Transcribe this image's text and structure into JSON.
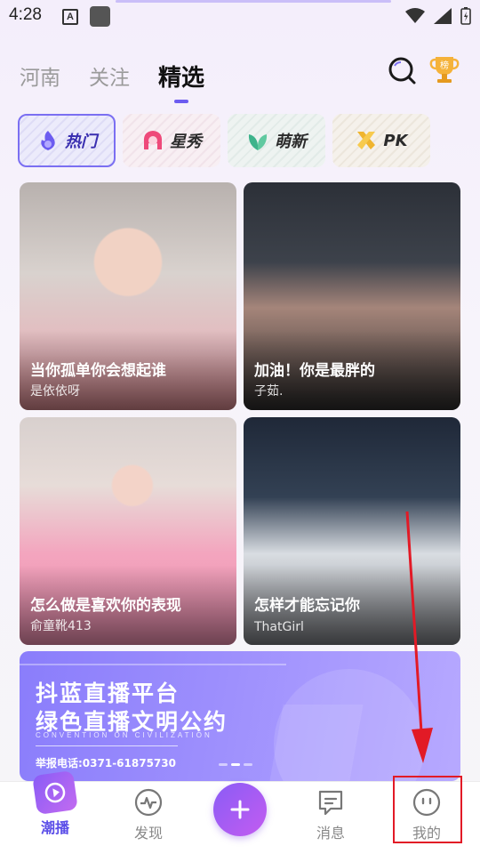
{
  "status_bar": {
    "time": "4:28",
    "a_icon": "A"
  },
  "tabs": [
    {
      "label": "河南",
      "active": false
    },
    {
      "label": "关注",
      "active": false
    },
    {
      "label": "精选",
      "active": true
    }
  ],
  "header_icons": {
    "search": "search-icon",
    "trophy": "trophy-icon",
    "trophy_badge": "榜"
  },
  "categories": [
    {
      "label": "热门",
      "icon": "fire-icon",
      "active": true
    },
    {
      "label": "星秀",
      "icon": "girl-icon",
      "active": false
    },
    {
      "label": "萌新",
      "icon": "leaf-icon",
      "active": false
    },
    {
      "label": "PK",
      "icon": "crossed-swords-icon",
      "active": false
    }
  ],
  "cards": [
    {
      "title": "当你孤单你会想起谁",
      "user": "是依依呀"
    },
    {
      "title": "加油！你是最胖的",
      "user": "子茹."
    },
    {
      "title": "怎么做是喜欢你的表现",
      "user": "俞童靴413"
    },
    {
      "title": "怎样才能忘记你",
      "user": "ThatGirl"
    }
  ],
  "banner": {
    "line1": "抖蓝直播平台",
    "line2": "绿色直播文明公约",
    "line3": "CONVENTION ON CIVILIZATION",
    "line4": "举报电话:0371-61875730"
  },
  "nav": [
    {
      "label": "潮播",
      "icon": "play-icon",
      "active": true
    },
    {
      "label": "发现",
      "icon": "pulse-icon",
      "active": false
    },
    {
      "label": "消息",
      "icon": "message-icon",
      "active": false
    },
    {
      "label": "我的",
      "icon": "face-icon",
      "active": false
    }
  ],
  "colors": {
    "accent": "#6c5cf0",
    "highlight": "#e21a26"
  }
}
